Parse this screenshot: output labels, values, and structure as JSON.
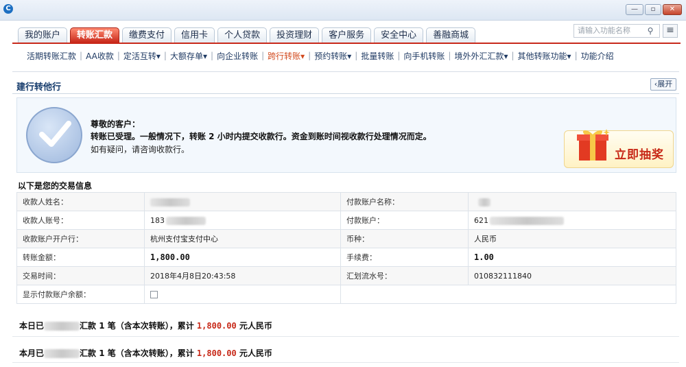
{
  "tabs": [
    "我的账户",
    "转账汇款",
    "缴费支付",
    "信用卡",
    "个人贷款",
    "投资理财",
    "客户服务",
    "安全中心",
    "善融商城"
  ],
  "search": {
    "placeholder": "请输入功能名称"
  },
  "subnav": [
    "活期转账汇款",
    "AA收款",
    "定活互转",
    "大额存单",
    "向企业转账",
    "跨行转账",
    "预约转账",
    "批量转账",
    "向手机转账",
    "境外外汇汇款",
    "其他转账功能",
    "功能介绍"
  ],
  "subnav_dropdowns": [
    "定活互转",
    "大额存单",
    "跨行转账",
    "预约转账",
    "境外外汇汇款",
    "其他转账功能"
  ],
  "section": {
    "title": "建行转他行",
    "expand_label": "展开"
  },
  "success": {
    "greeting": "尊敬的客户：",
    "line1": "转账已受理。一般情况下，转账 2 小时内提交收款行。资金到账时间视收款行处理情况而定。",
    "line2": "如有疑问，请咨询收款行。"
  },
  "lottery": {
    "label": "立即抽奖"
  },
  "info": {
    "title": "以下是您的交易信息",
    "payee_name_label": "收款人姓名：",
    "payer_name_label": "付款账户名称：",
    "payee_account_label": "收款人账号：",
    "payee_account_prefix": "183",
    "payer_account_label": "付款账户：",
    "payer_account_prefix": "621",
    "payee_bank_label": "收款账户开户行：",
    "payee_bank": "杭州支付宝支付中心",
    "currency_label": "币种：",
    "currency": "人民币",
    "amount_label": "转账金额：",
    "amount": "1,800.00",
    "fee_label": "手续费：",
    "fee": "1.00",
    "time_label": "交易时间：",
    "time": "2018年4月8日20:43:58",
    "serial_label": "汇划流水号：",
    "serial": "010832111840",
    "balance_label": "显示付款账户余额："
  },
  "summary": {
    "day_prefix": "本日已",
    "day_mid": "汇款 1 笔（含本次转账），累计",
    "day_amount": "1,800.00",
    "day_suffix": "元人民币",
    "month_prefix": "本月已",
    "month_mid": "汇款 1 笔（含本次转账），累计",
    "month_amount": "1,800.00",
    "month_suffix": "元人民币"
  }
}
